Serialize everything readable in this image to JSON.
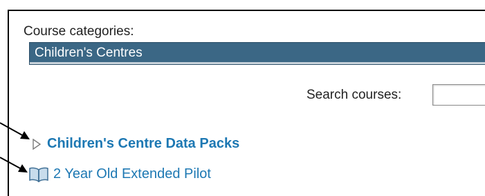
{
  "categories": {
    "label": "Course categories:",
    "selected": "Children's Centres"
  },
  "search": {
    "label": "Search courses:",
    "value": ""
  },
  "category_list": {
    "items": [
      {
        "label": "Children's Centre Data Packs",
        "icon": "collapsed-triangle-icon"
      }
    ]
  },
  "course_list": {
    "items": [
      {
        "label": "2 Year Old Extended Pilot",
        "icon": "book-icon"
      }
    ]
  }
}
